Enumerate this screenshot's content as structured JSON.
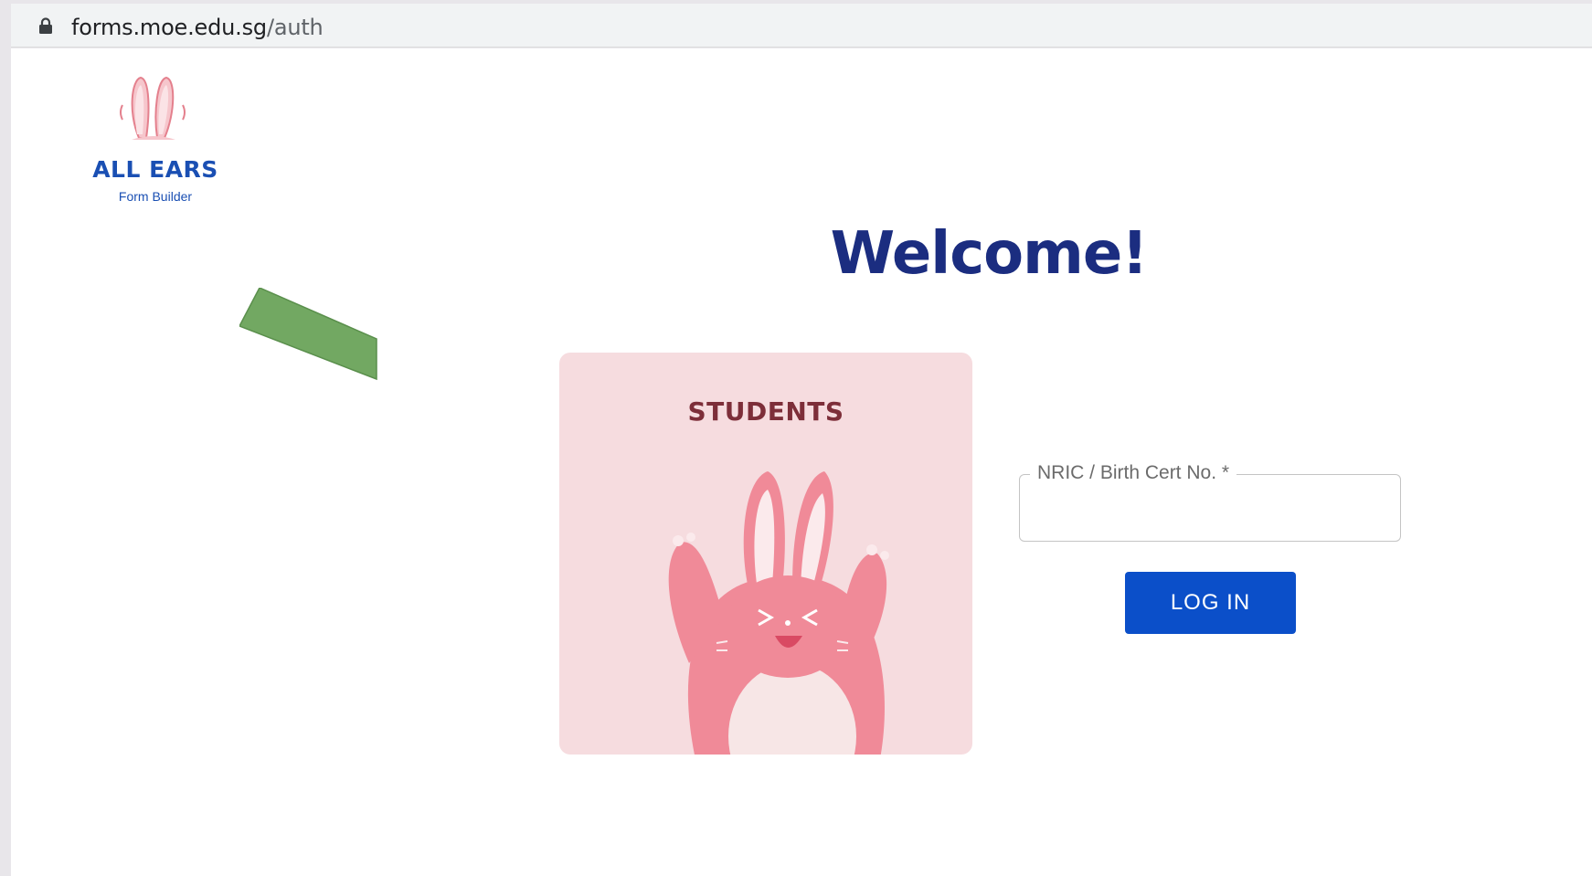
{
  "browser": {
    "url_domain": "forms.moe.edu.sg",
    "url_path": "/auth"
  },
  "logo": {
    "title": "ALL EARS",
    "subtitle": "Form Builder"
  },
  "main": {
    "heading": "Welcome!",
    "card_label": "STUDENTS"
  },
  "form": {
    "field_label": "NRIC / Birth Cert No. *",
    "field_value": "",
    "login_label": "LOG IN"
  },
  "colors": {
    "brand_blue": "#0b4fc9",
    "heading_navy": "#1b2d80",
    "card_pink": "#f6dcdf",
    "bunny_pink": "#f08a98",
    "annotation_green": "#72a862"
  }
}
